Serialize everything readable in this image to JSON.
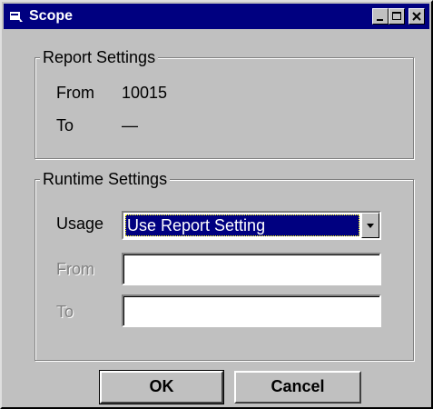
{
  "window": {
    "title": "Scope"
  },
  "report_settings": {
    "legend": "Report Settings",
    "from_label": "From",
    "from_value": "10015",
    "to_label": "To",
    "to_value": "—"
  },
  "runtime_settings": {
    "legend": "Runtime Settings",
    "usage_label": "Usage",
    "usage_value": "Use Report Setting",
    "from_label": "From",
    "from_value": "",
    "to_label": "To",
    "to_value": ""
  },
  "buttons": {
    "ok": "OK",
    "cancel": "Cancel"
  },
  "colors": {
    "titlebar": "#000080",
    "face": "#c0c0c0",
    "selection": "#000080"
  }
}
